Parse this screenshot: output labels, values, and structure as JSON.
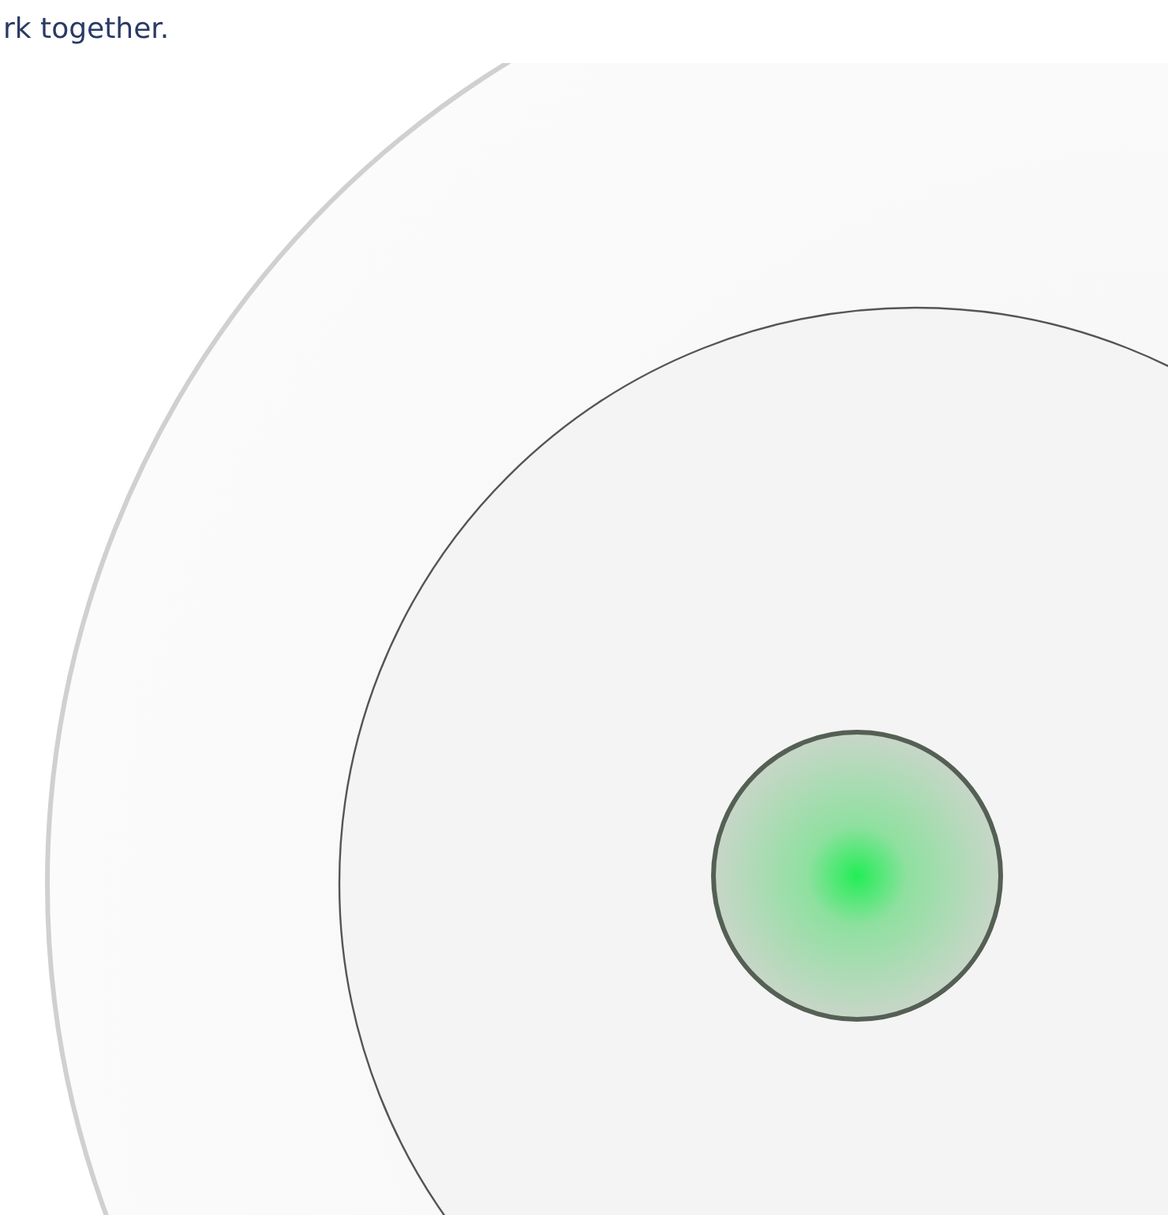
{
  "intro": {
    "text": "rk together."
  }
}
